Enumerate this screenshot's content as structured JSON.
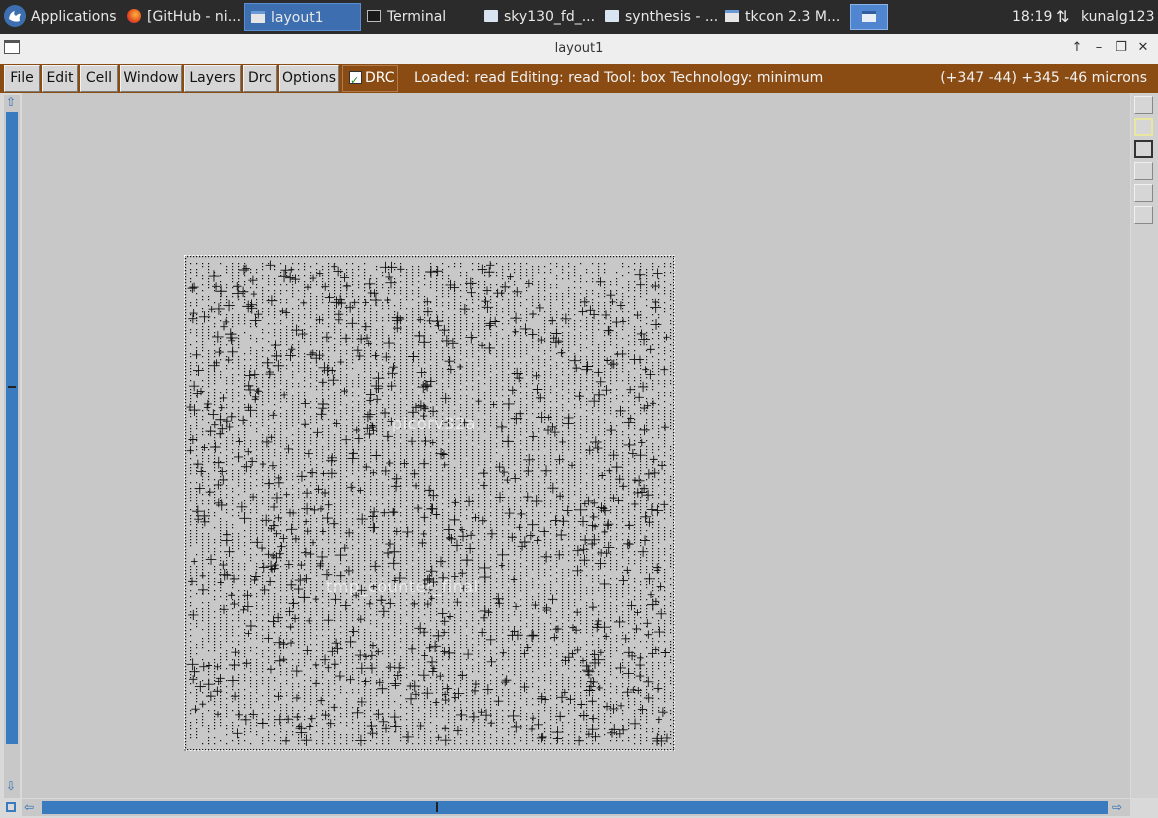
{
  "panel": {
    "applications_label": "Applications",
    "tasks": [
      {
        "label": "[GitHub - ni...",
        "icon": "firefox-icon"
      },
      {
        "label": "layout1",
        "icon": "window-icon",
        "active": true
      },
      {
        "label": "Terminal",
        "icon": "terminal-icon"
      },
      {
        "label": "sky130_fd_...",
        "icon": "folder-icon"
      },
      {
        "label": "synthesis - ...",
        "icon": "folder-icon"
      },
      {
        "label": "tkcon 2.3 M...",
        "icon": "window-icon"
      }
    ],
    "clock": "18:19",
    "user": "kunalg123"
  },
  "window": {
    "title": "layout1"
  },
  "menubar": {
    "items": [
      "File",
      "Edit",
      "Cell",
      "Window",
      "Layers",
      "Drc",
      "Options"
    ],
    "drc_label": "DRC",
    "drc_checked": true,
    "status": "Loaded: read Editing: read Tool: box  Technology: minimum",
    "coords": "(+347 -44) +345 -46 microns"
  },
  "colors": {
    "panel_bg": "#2b2b2b",
    "menubar_bg": "#8b4c14",
    "scrollbar": "#3a7abf",
    "canvas_bg": "#c8c8c8"
  },
  "cell": {
    "labels": [
      "picorv32a",
      "tmp_counter_final"
    ]
  }
}
